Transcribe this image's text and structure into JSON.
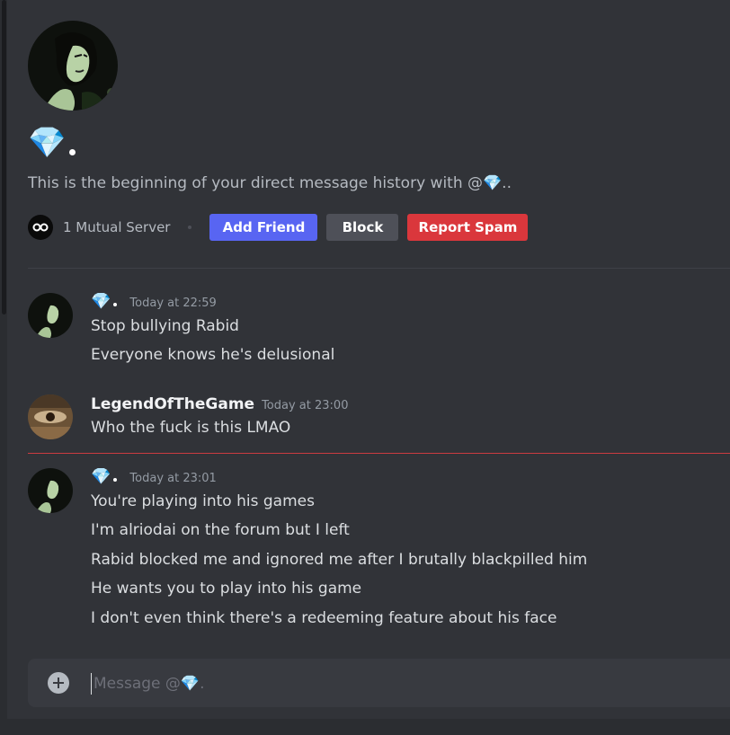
{
  "profile": {
    "display_name_icon": "💎",
    "intro_text": "This is the beginning of your direct message history with @💎..",
    "mutual_servers": "1 Mutual Server",
    "add_friend_label": "Add Friend",
    "block_label": "Block",
    "report_spam_label": "Report Spam"
  },
  "messages": [
    {
      "author": "💎",
      "timestamp": "Today at 22:59",
      "lines": [
        "Stop bullying Rabid",
        "Everyone knows he's delusional"
      ]
    },
    {
      "author": "LegendOfTheGame",
      "timestamp": "Today at 23:00",
      "lines": [
        "Who the fuck is this LMAO"
      ]
    },
    {
      "author": "💎",
      "timestamp": "Today at 23:01",
      "lines": [
        "You're playing into his games",
        "I'm alriodai on the forum but I left",
        "Rabid blocked me and ignored me after I brutally blackpilled him",
        "He wants you to play into his game",
        "I don't even think there's a redeeming feature about his face"
      ]
    }
  ],
  "composer": {
    "placeholder": "Message @💎."
  },
  "colors": {
    "accent": "#5865f2",
    "danger": "#da373c",
    "new_messages_line": "#f23f43"
  }
}
